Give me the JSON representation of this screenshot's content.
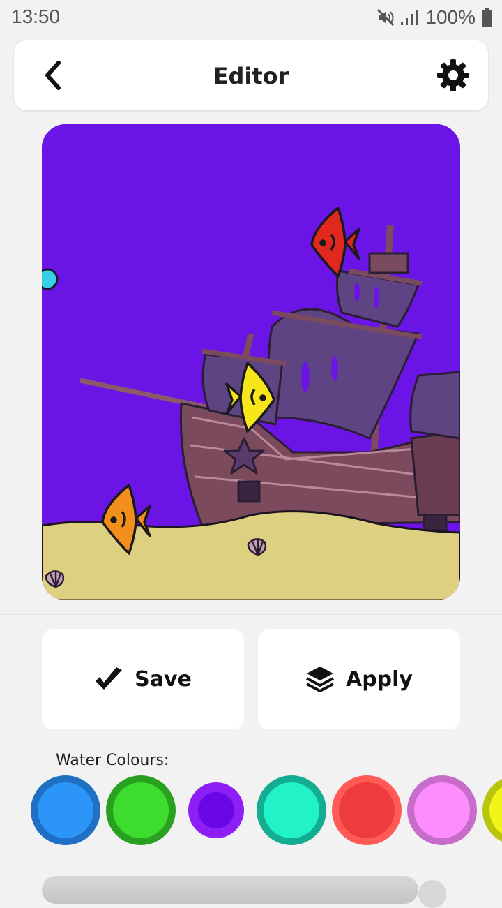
{
  "status": {
    "time": "13:50",
    "battery": "100%"
  },
  "header": {
    "title": "Editor"
  },
  "actions": {
    "save_label": "Save",
    "apply_label": "Apply"
  },
  "colours": {
    "label": "Water Colours:",
    "swatches": [
      {
        "name": "blue",
        "ring": "#1f6fc4",
        "fill": "#2b95f8"
      },
      {
        "name": "green",
        "ring": "#2aa020",
        "fill": "#3ddc2f"
      },
      {
        "name": "purple",
        "ring": "#8d1ef5",
        "fill": "#6a06e6",
        "selected": true
      },
      {
        "name": "turquoise",
        "ring": "#14ad92",
        "fill": "#21f2c8"
      },
      {
        "name": "red",
        "ring": "#ff5a55",
        "fill": "#ee3b3b"
      },
      {
        "name": "pink",
        "ring": "#c86ccc",
        "fill": "#fd8cfc"
      },
      {
        "name": "yellow",
        "ring": "#b9c40d",
        "fill": "#f0f51a"
      }
    ]
  },
  "canvas": {
    "water_color": "#6a14e6",
    "sand_color": "#ded081"
  }
}
